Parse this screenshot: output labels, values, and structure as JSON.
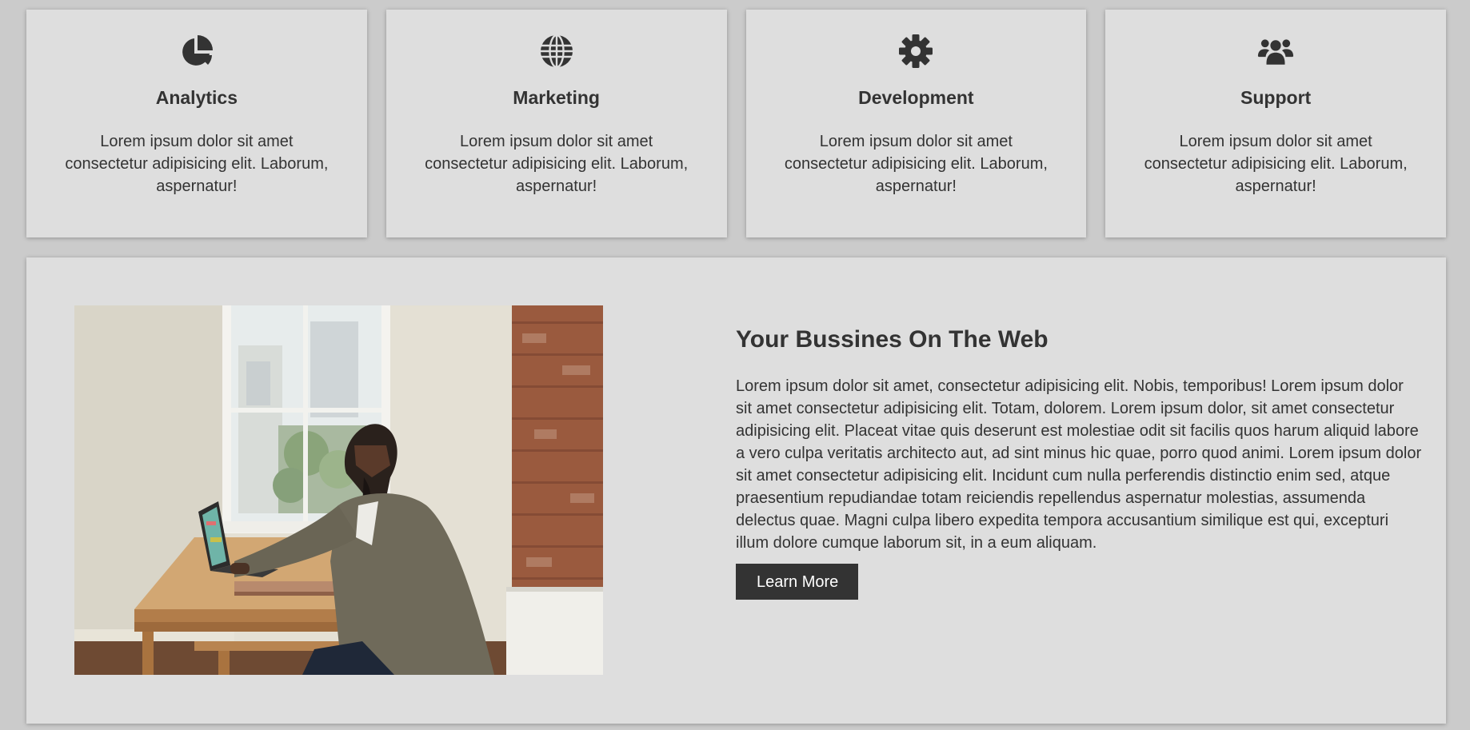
{
  "services": [
    {
      "icon": "pie-chart-icon",
      "title": "Analytics",
      "text": "Lorem ipsum dolor sit amet consectetur adipisicing elit. Laborum, aspernatur!"
    },
    {
      "icon": "globe-icon",
      "title": "Marketing",
      "text": "Lorem ipsum dolor sit amet consectetur adipisicing elit. Laborum, aspernatur!"
    },
    {
      "icon": "gear-icon",
      "title": "Development",
      "text": "Lorem ipsum dolor sit amet consectetur adipisicing elit. Laborum, aspernatur!"
    },
    {
      "icon": "users-icon",
      "title": "Support",
      "text": "Lorem ipsum dolor sit amet consectetur adipisicing elit. Laborum, aspernatur!"
    }
  ],
  "feature": {
    "image": "photo of man working on laptop at wooden desk beside window and brick wall",
    "title": "Your Bussines On The Web",
    "text": "Lorem ipsum dolor sit amet, consectetur adipisicing elit. Nobis, temporibus! Lorem ipsum dolor sit amet consectetur adipisicing elit. Totam, dolorem. Lorem ipsum dolor, sit amet consectetur adipisicing elit. Placeat vitae quis deserunt est molestiae odit sit facilis quos harum aliquid labore a vero culpa veritatis architecto aut, ad sint minus hic quae, porro quod animi. Lorem ipsum dolor sit amet consectetur adipisicing elit. Incidunt cum nulla perferendis distinctio enim sed, atque praesentium repudiandae totam reiciendis repellendus aspernatur molestias, assumenda delectus quae. Magni culpa libero expedita tempora accusantium similique est qui, excepturi illum dolore cumque laborum sit, in a eum aliquam.",
    "button_label": "Learn More"
  },
  "colors": {
    "page_background": "#cbcbcb",
    "card_background": "#dedede",
    "text": "#333333",
    "button_background": "#333333",
    "button_text": "#ffffff"
  }
}
